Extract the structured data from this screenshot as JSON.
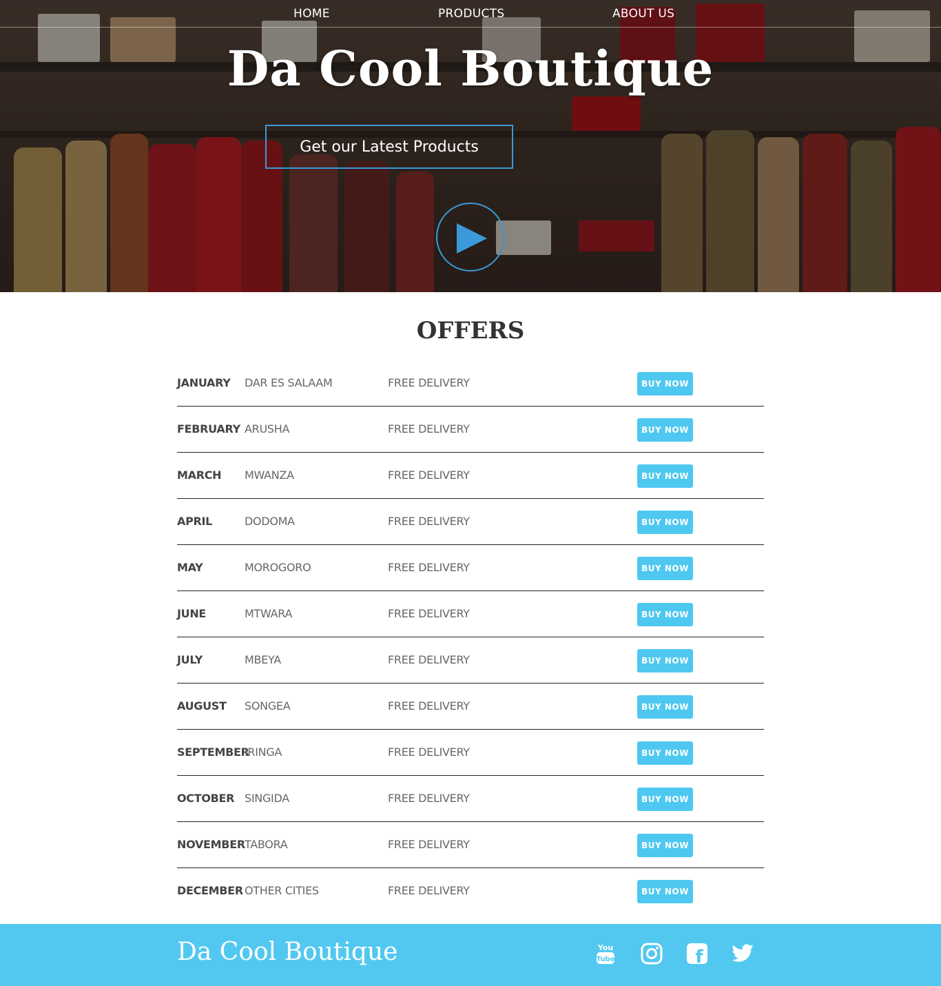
{
  "nav": {
    "items": [
      {
        "label": "HOME"
      },
      {
        "label": "PRODUCTS"
      },
      {
        "label": "ABOUT US"
      }
    ]
  },
  "hero": {
    "title": "Da Cool Boutique",
    "cta_label": "Get our Latest Products",
    "play_icon": "play-icon"
  },
  "offers": {
    "title": "OFFERS",
    "rows": [
      {
        "month": "JANUARY",
        "city": "DAR ES SALAAM",
        "deal": "FREE DELIVERY",
        "button": "BUY NOW"
      },
      {
        "month": "FEBRUARY",
        "city": "ARUSHA",
        "deal": "FREE DELIVERY",
        "button": "BUY NOW"
      },
      {
        "month": "MARCH",
        "city": "MWANZA",
        "deal": "FREE DELIVERY",
        "button": "BUY NOW"
      },
      {
        "month": "APRIL",
        "city": "DODOMA",
        "deal": "FREE DELIVERY",
        "button": "BUY NOW"
      },
      {
        "month": "MAY",
        "city": "MOROGORO",
        "deal": "FREE DELIVERY",
        "button": "BUY NOW"
      },
      {
        "month": "JUNE",
        "city": "MTWARA",
        "deal": "FREE DELIVERY",
        "button": "BUY NOW"
      },
      {
        "month": "JULY",
        "city": "MBEYA",
        "deal": "FREE DELIVERY",
        "button": "BUY NOW"
      },
      {
        "month": "AUGUST",
        "city": "SONGEA",
        "deal": "FREE DELIVERY",
        "button": "BUY NOW"
      },
      {
        "month": "SEPTEMBER",
        "city": "IRINGA",
        "deal": "FREE DELIVERY",
        "button": "BUY NOW"
      },
      {
        "month": "OCTOBER",
        "city": "SINGIDA",
        "deal": "FREE DELIVERY",
        "button": "BUY NOW"
      },
      {
        "month": "NOVEMBER",
        "city": "TABORA",
        "deal": "FREE DELIVERY",
        "button": "BUY NOW"
      },
      {
        "month": "DECEMBER",
        "city": "OTHER CITIES",
        "deal": "FREE DELIVERY",
        "button": "BUY NOW"
      }
    ]
  },
  "footer": {
    "brand": "Da Cool Boutique",
    "social": [
      {
        "icon": "youtube-icon",
        "glyph_top": "You",
        "glyph_bottom": "Tube"
      },
      {
        "icon": "instagram-icon"
      },
      {
        "icon": "facebook-icon",
        "glyph": "f"
      },
      {
        "icon": "twitter-icon"
      }
    ]
  },
  "colors": {
    "accent_blue": "#3a9ad9",
    "button_blue": "#4ec8f0",
    "footer_blue": "#52c8f0",
    "text_dark": "#333333"
  }
}
